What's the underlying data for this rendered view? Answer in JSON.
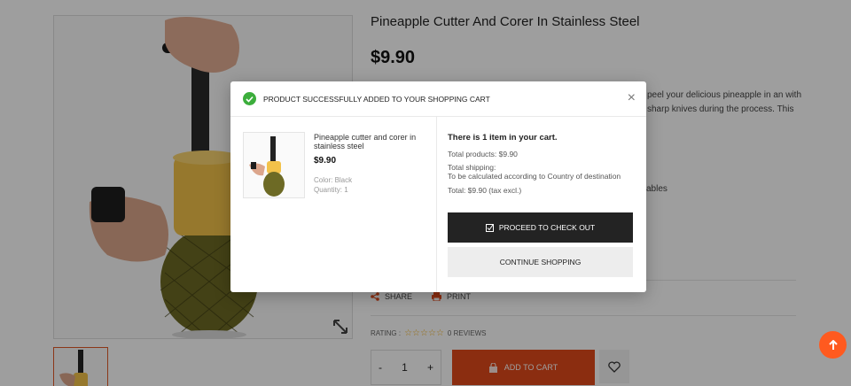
{
  "product": {
    "title": "Pineapple Cutter And Corer In Stainless Steel",
    "price": "$9.90",
    "description": "peel your delicious pineapple in an with sharp knives during the process. This",
    "extra_text": "ables"
  },
  "actions": {
    "share_label": "SHARE",
    "print_label": "PRINT",
    "rating_label": "RATING :",
    "rating_stars": "☆☆☆☆☆",
    "reviews_label": "0 REVIEWS",
    "qty_minus": "-",
    "qty_value": "1",
    "qty_plus": "+",
    "add_to_cart_label": "ADD TO CART"
  },
  "modal": {
    "header": "PRODUCT SUCCESSFULLY ADDED TO YOUR SHOPPING CART",
    "close": "×",
    "item_name": "Pineapple cutter and corer in stainless steel",
    "item_price": "$9.90",
    "item_color": "Color: Black",
    "item_quantity": "Quantity: 1",
    "cart_count": "There is 1 item in your cart.",
    "total_products": "Total products: $9.90",
    "total_shipping_label": "Total shipping:",
    "total_shipping_value": "To be calculated according to Country of destination",
    "total": "Total: $9.90 (tax excl.)",
    "checkout_label": "PROCEED TO CHECK OUT",
    "continue_label": "CONTINUE SHOPPING"
  },
  "colors": {
    "accent": "#e0491b",
    "success": "#3cae3c",
    "dark_button": "#232323"
  },
  "icons": [
    "check-circle-icon",
    "close-icon",
    "share-icon",
    "print-icon",
    "star-icon",
    "lock-icon",
    "heart-icon",
    "arrow-up-icon",
    "expand-icon",
    "checkbox-icon"
  ]
}
